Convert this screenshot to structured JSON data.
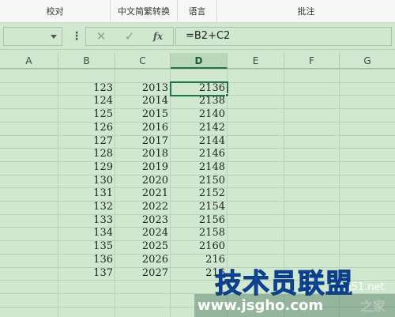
{
  "ribbon": {
    "groups": [
      "校对",
      "中文简繁转换",
      "语言",
      "批注"
    ]
  },
  "formula_bar": {
    "name_box": "",
    "dots": "⋮",
    "cancel_icon": "✕",
    "enter_icon": "✓",
    "fx_label": "fx",
    "formula": "=B2+C2"
  },
  "columns": [
    "A",
    "B",
    "C",
    "D",
    "E",
    "F",
    "G"
  ],
  "selected_column": "D",
  "rows": [
    {
      "b": "123",
      "c": "2013",
      "d": "2136"
    },
    {
      "b": "124",
      "c": "2014",
      "d": "2138"
    },
    {
      "b": "125",
      "c": "2015",
      "d": "2140"
    },
    {
      "b": "126",
      "c": "2016",
      "d": "2142"
    },
    {
      "b": "127",
      "c": "2017",
      "d": "2144"
    },
    {
      "b": "128",
      "c": "2018",
      "d": "2146"
    },
    {
      "b": "129",
      "c": "2019",
      "d": "2148"
    },
    {
      "b": "130",
      "c": "2020",
      "d": "2150"
    },
    {
      "b": "131",
      "c": "2021",
      "d": "2152"
    },
    {
      "b": "132",
      "c": "2022",
      "d": "2154"
    },
    {
      "b": "133",
      "c": "2023",
      "d": "2156"
    },
    {
      "b": "134",
      "c": "2024",
      "d": "2158"
    },
    {
      "b": "135",
      "c": "2025",
      "d": "2160"
    },
    {
      "b": "136",
      "c": "2026",
      "d": "216"
    },
    {
      "b": "137",
      "c": "2027",
      "d": "216"
    }
  ],
  "watermark": {
    "main": "技术员联盟",
    "url": "www.jsgho.com",
    "side1": "j51.net",
    "side2": "之家"
  }
}
